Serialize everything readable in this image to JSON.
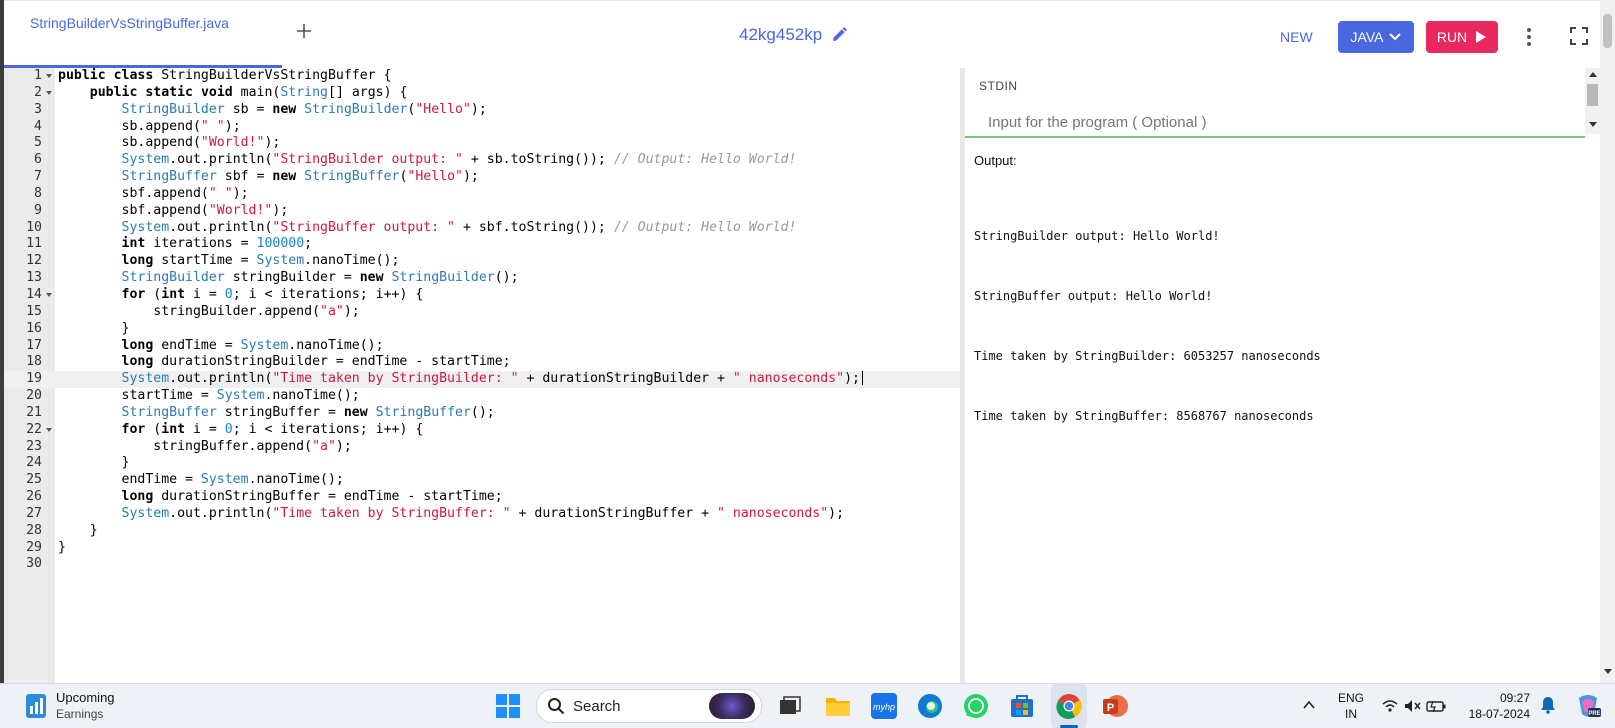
{
  "header": {
    "tab_filename": "StringBuilderVsStringBuffer.java",
    "project_id": "42kg452kp",
    "new_label": "NEW",
    "language_label": "JAVA",
    "run_label": "RUN",
    "accent_color": "#4a67e0",
    "run_color": "#e8285f"
  },
  "editor": {
    "active_line": 19,
    "lines": [
      {
        "n": "1"
      },
      {
        "n": "2"
      },
      {
        "n": "3"
      },
      {
        "n": "4"
      },
      {
        "n": "5"
      },
      {
        "n": "6"
      },
      {
        "n": "7"
      },
      {
        "n": "8"
      },
      {
        "n": "9"
      },
      {
        "n": "10"
      },
      {
        "n": "11"
      },
      {
        "n": "12"
      },
      {
        "n": "13"
      },
      {
        "n": "14"
      },
      {
        "n": "15"
      },
      {
        "n": "16"
      },
      {
        "n": "17"
      },
      {
        "n": "18"
      },
      {
        "n": "19"
      },
      {
        "n": "20"
      },
      {
        "n": "21"
      },
      {
        "n": "22"
      },
      {
        "n": "23"
      },
      {
        "n": "24"
      },
      {
        "n": "25"
      },
      {
        "n": "26"
      },
      {
        "n": "27"
      },
      {
        "n": "28"
      },
      {
        "n": "29"
      },
      {
        "n": "30"
      }
    ],
    "code": [
      "public class StringBuilderVsStringBuffer {",
      "    public static void main(String[] args) {",
      "        StringBuilder sb = new StringBuilder(\"Hello\");",
      "        sb.append(\" \");",
      "        sb.append(\"World!\");",
      "        System.out.println(\"StringBuilder output: \" + sb.toString()); // Output: Hello World!",
      "        StringBuffer sbf = new StringBuffer(\"Hello\");",
      "        sbf.append(\" \");",
      "        sbf.append(\"World!\");",
      "        System.out.println(\"StringBuffer output: \" + sbf.toString()); // Output: Hello World!",
      "        int iterations = 100000;",
      "        long startTime = System.nanoTime();",
      "        StringBuilder stringBuilder = new StringBuilder();",
      "        for (int i = 0; i < iterations; i++) {",
      "            stringBuilder.append(\"a\");",
      "        }",
      "        long endTime = System.nanoTime();",
      "        long durationStringBuilder = endTime - startTime;",
      "        System.out.println(\"Time taken by StringBuilder: \" + durationStringBuilder + \" nanoseconds\");",
      "        startTime = System.nanoTime();",
      "        StringBuffer stringBuffer = new StringBuffer();",
      "        for (int i = 0; i < iterations; i++) {",
      "            stringBuffer.append(\"a\");",
      "        }",
      "        endTime = System.nanoTime();",
      "        long durationStringBuffer = endTime - startTime;",
      "        System.out.println(\"Time taken by StringBuffer: \" + durationStringBuffer + \" nanoseconds\");",
      "    }",
      "}",
      ""
    ],
    "fold_lines": [
      1,
      2,
      14,
      22
    ]
  },
  "stdin": {
    "label": "STDIN",
    "placeholder": "Input for the program ( Optional )"
  },
  "output": {
    "label": "Output:",
    "lines": [
      "StringBuilder output: Hello World!",
      "StringBuffer output: Hello World!",
      "Time taken by StringBuilder: 6053257 nanoseconds",
      "Time taken by StringBuffer: 8568767 nanoseconds"
    ]
  },
  "taskbar": {
    "weather_title": "Upcoming",
    "weather_sub": "Earnings",
    "search_label": "Search",
    "lang_line1": "ENG",
    "lang_line2": "IN",
    "time": "09:27",
    "date": "18-07-2024",
    "apps": [
      "task-view-icon",
      "file-explorer-icon",
      "myhp-icon",
      "edge-icon",
      "whatsapp-icon",
      "store-icon",
      "chrome-icon",
      "powerpoint-icon"
    ]
  }
}
